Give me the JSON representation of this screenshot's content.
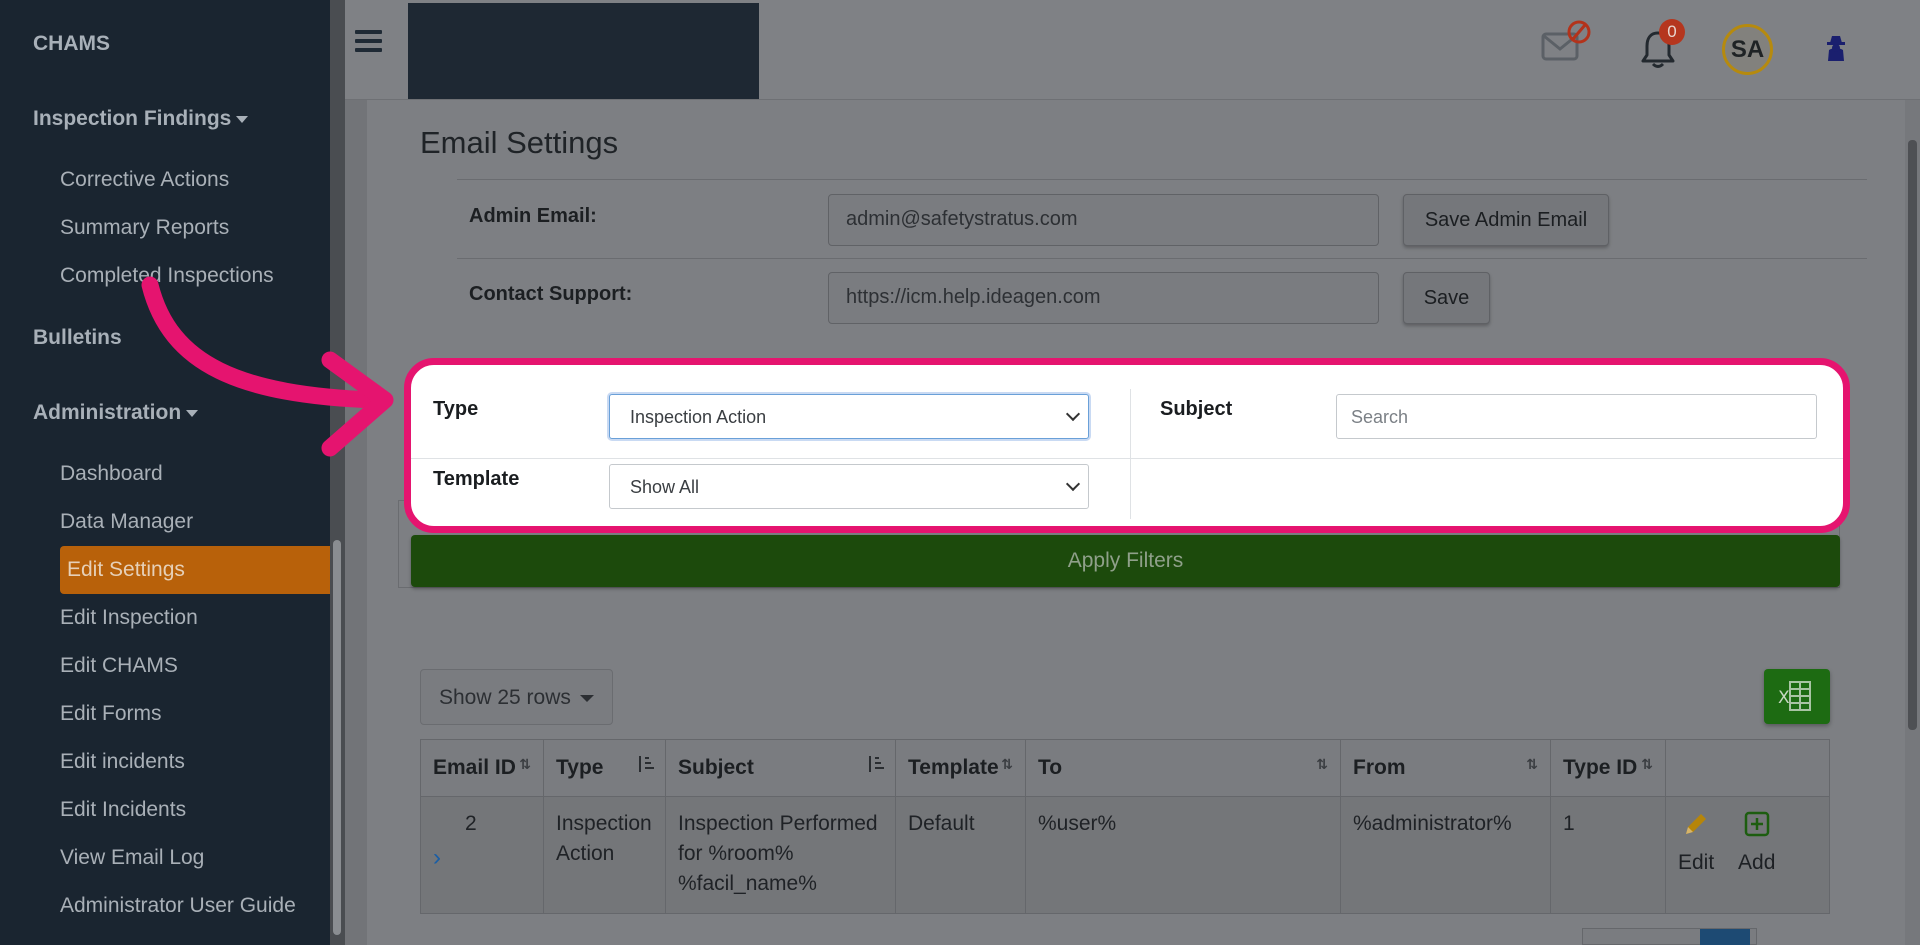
{
  "sidebar": {
    "app_title": "CHAMS",
    "sections": [
      {
        "label": "Inspection Findings",
        "items": [
          "Corrective Actions",
          "Summary Reports",
          "Completed Inspections"
        ]
      },
      {
        "label": "Bulletins"
      },
      {
        "label": "Administration",
        "items": [
          "Dashboard",
          "Data Manager",
          "Edit Settings",
          "Edit Inspection",
          "Edit CHAMS",
          "Edit Forms",
          "Edit incidents",
          "Edit Incidents",
          "View Email Log",
          "Administrator User Guide"
        ]
      }
    ],
    "active_item": "Edit Settings"
  },
  "topbar": {
    "notification_count": "0",
    "avatar_initials": "SA"
  },
  "email_settings": {
    "title": "Email Settings",
    "admin_email_label": "Admin Email:",
    "admin_email_value": "admin@safetystratus.com",
    "save_admin_email": "Save Admin Email",
    "contact_support_label": "Contact Support:",
    "contact_support_value": "https://icm.help.ideagen.com",
    "save": "Save"
  },
  "filters": {
    "type_label": "Type",
    "type_value": "Inspection Action",
    "subject_label": "Subject",
    "subject_placeholder": "Search",
    "template_label": "Template",
    "template_value": "Show All",
    "apply": "Apply Filters"
  },
  "table": {
    "rows_selector": "Show 25 rows",
    "columns": [
      "Email ID",
      "Type",
      "Subject",
      "Template",
      "To",
      "From",
      "Type ID",
      ""
    ],
    "rows": [
      {
        "email_id": "2",
        "type": "Inspection Action",
        "subject": "Inspection Performed for %room% %facil_name%",
        "template": "Default",
        "to": "%user%",
        "from": "%administrator%",
        "type_id": "1",
        "edit": "Edit",
        "add": "Add"
      }
    ]
  },
  "colors": {
    "highlight": "#e5146f",
    "apply_button": "#1c4a0c",
    "active_nav": "#b8610a",
    "excel": "#1d6b12"
  }
}
